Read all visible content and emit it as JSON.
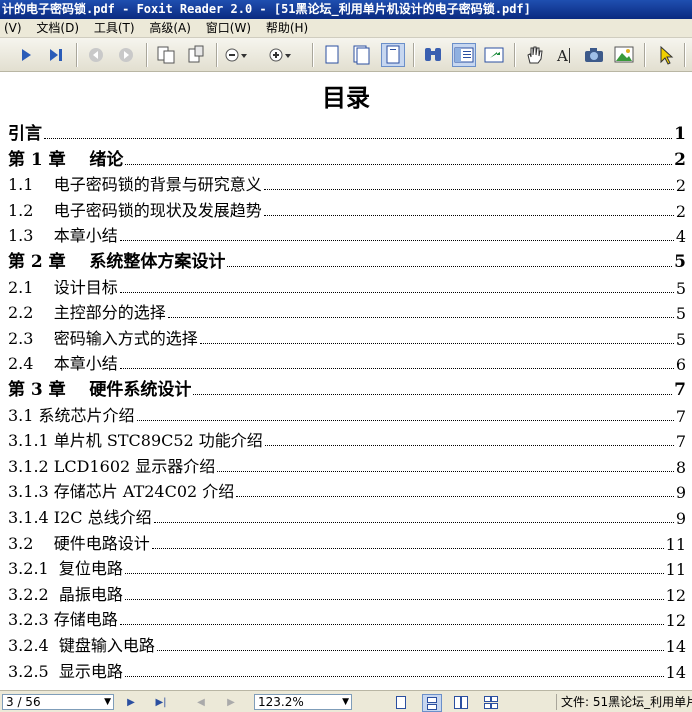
{
  "window": {
    "title": "计的电子密码锁.pdf - Foxit Reader 2.0 - [51黑论坛_利用单片机设计的电子密码锁.pdf]"
  },
  "menu": {
    "items": [
      "(V)",
      "文档(D)",
      "工具(T)",
      "高级(A)",
      "窗口(W)",
      "帮助(H)"
    ]
  },
  "toolbar": {
    "icons": [
      "play-icon",
      "last-page-icon",
      "back-icon",
      "forward-icon",
      "copy-page-icon",
      "paste-page-icon",
      "zoom-out-icon",
      "zoom-in-icon",
      "single-page-icon",
      "continuous-page-icon",
      "facing-page-icon",
      "binoculars-icon",
      "bookmark-panel-icon",
      "export-icon",
      "hand-tool-icon",
      "text-select-icon",
      "snapshot-icon",
      "image-tool-icon",
      "select-cursor-icon"
    ]
  },
  "document": {
    "heading": "目录",
    "toc": [
      {
        "label": "引言",
        "page": "1",
        "type": "chapter"
      },
      {
        "label": "第 1 章    绪论",
        "page": "2",
        "type": "chapter"
      },
      {
        "label": "1.1    电子密码锁的背景与研究意义",
        "page": "2",
        "type": "section"
      },
      {
        "label": "1.2    电子密码锁的现状及发展趋势",
        "page": "2",
        "type": "section"
      },
      {
        "label": "1.3    本章小结",
        "page": "4",
        "type": "section"
      },
      {
        "label": "第 2 章    系统整体方案设计",
        "page": "5",
        "type": "chapter"
      },
      {
        "label": "2.1    设计目标",
        "page": "5",
        "type": "section"
      },
      {
        "label": "2.2    主控部分的选择",
        "page": "5",
        "type": "section"
      },
      {
        "label": "2.3    密码输入方式的选择",
        "page": "5",
        "type": "section"
      },
      {
        "label": "2.4    本章小结",
        "page": "6",
        "type": "section"
      },
      {
        "label": "第 3 章    硬件系统设计",
        "page": "7",
        "type": "chapter"
      },
      {
        "label": "3.1 系统芯片介绍",
        "page": "7",
        "type": "section"
      },
      {
        "label": "3.1.1 单片机 STC89C52 功能介绍",
        "page": "7",
        "type": "section"
      },
      {
        "label": "3.1.2 LCD1602 显示器介绍",
        "page": "8",
        "type": "section"
      },
      {
        "label": "3.1.3 存储芯片 AT24C02 介绍",
        "page": "9",
        "type": "section"
      },
      {
        "label": "3.1.4 I2C 总线介绍",
        "page": "9",
        "type": "section"
      },
      {
        "label": "3.2    硬件电路设计",
        "page": "11",
        "type": "section"
      },
      {
        "label": "3.2.1  复位电路",
        "page": "11",
        "type": "section"
      },
      {
        "label": "3.2.2  晶振电路",
        "page": "12",
        "type": "section"
      },
      {
        "label": "3.2.3 存储电路",
        "page": "12",
        "type": "section"
      },
      {
        "label": "3.2.4  键盘输入电路",
        "page": "14",
        "type": "section"
      },
      {
        "label": "3.2.5  显示电路",
        "page": "14",
        "type": "section"
      }
    ]
  },
  "status": {
    "page_indicator": "3 / 56",
    "zoom": "123.2%",
    "file_label": "文件: 51黑论坛_利用单片"
  }
}
